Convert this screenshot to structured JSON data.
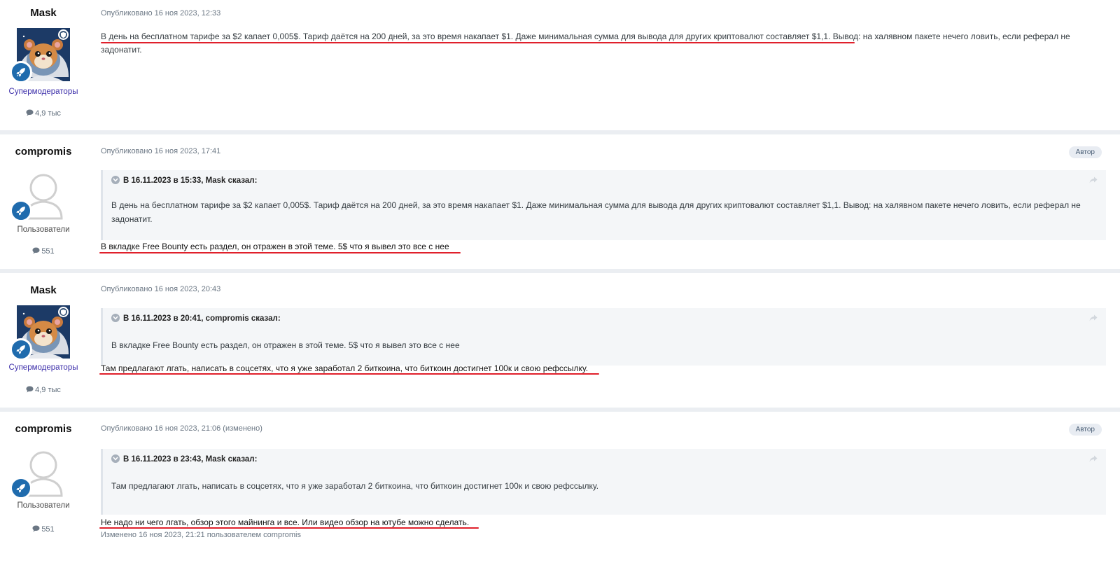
{
  "posts": [
    {
      "author": "Mask",
      "group": "Супермодераторы",
      "post_count": "4,9 тыс",
      "meta": "Опубликовано 16 ноя 2023, 12:33",
      "text": "В день на бесплатном тарифе за $2 капает 0,005$. Тариф даётся на 200 дней, за это время накапает $1. Даже минимальная сумма для вывода для других криптовалют составляет $1,1. Вывод: на халявном пакете нечего ловить, если реферал не задонатит."
    },
    {
      "author": "compromis",
      "group": "Пользователи",
      "post_count": "551",
      "meta": "Опубликовано 16 ноя 2023, 17:41",
      "badge": "Автор",
      "quote_header": "В 16.11.2023 в 15:33, Mask сказал:",
      "quote_text": "В день на бесплатном тарифе за $2 капает 0,005$. Тариф даётся на 200 дней, за это время накапает $1. Даже минимальная сумма для вывода для других криптовалют составляет $1,1. Вывод: на халявном пакете нечего ловить, если реферал не задонатит.",
      "text": "В вкладке Free Bounty есть раздел, он отражен в этой теме.  5$ что я вывел это все с нее"
    },
    {
      "author": "Mask",
      "group": "Супермодераторы",
      "post_count": "4,9 тыс",
      "meta": "Опубликовано 16 ноя 2023, 20:43",
      "quote_header": "В 16.11.2023 в 20:41, compromis сказал:",
      "quote_text": "В вкладке Free Bounty есть раздел, он отражен в этой теме.  5$ что я вывел это все с нее",
      "text": "Там предлагают лгать, написать в соцсетях, что я уже заработал 2 биткоина, что биткоин достигнет 100к и свою рефссылку."
    },
    {
      "author": "compromis",
      "group": "Пользователи",
      "post_count": "551",
      "meta": "Опубликовано 16 ноя 2023, 21:06 (изменено)",
      "badge": "Автор",
      "quote_header": "В 16.11.2023 в 23:43, Mask сказал:",
      "quote_text": "Там предлагают лгать, написать в соцсетях, что я уже заработал 2 биткоина, что биткоин достигнет 100к и свою рефссылку.",
      "text": "Не надо ни чего лгать, обзор этого майнинга и все. Или видео обзор на ютубе можно сделать.",
      "edited": "Изменено 16 ноя 2023, 21:21 пользователем compromis"
    }
  ],
  "icons": {
    "rocket": "rocket-icon",
    "shield": "shield-icon",
    "comment": "comment-icon",
    "share": "share-icon",
    "quote_toggle": "chevron-down-icon"
  },
  "colors": {
    "moderator_group": "#3d2faa",
    "badge_blue": "#1f6bad",
    "underline_red": "#e0202b"
  }
}
